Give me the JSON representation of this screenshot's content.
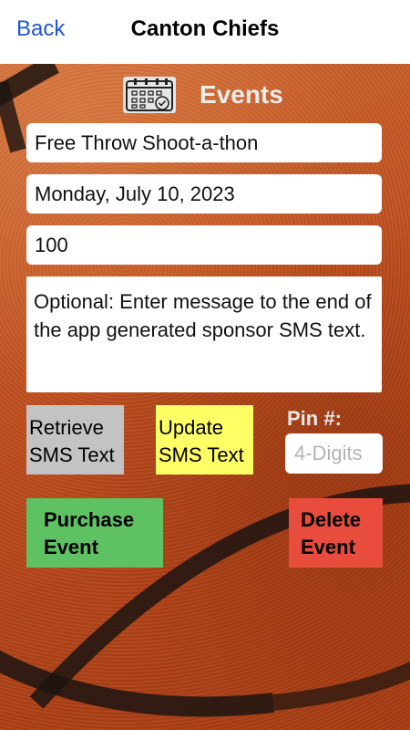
{
  "nav": {
    "back_label": "Back",
    "title": "Canton Chiefs"
  },
  "header": {
    "icon": "calendar-icon",
    "title": "Events"
  },
  "form": {
    "event_name": "Free Throw Shoot-a-thon",
    "event_date": "Monday, July 10, 2023",
    "amount": "100",
    "message_placeholder": "Optional: Enter message to the end of the app generated sponsor SMS text."
  },
  "buttons": {
    "retrieve_line1": "Retrieve",
    "retrieve_line2": "SMS Text",
    "update_line1": "Update",
    "update_line2": "SMS Text",
    "purchase_line1": "Purchase",
    "purchase_line2": "Event",
    "delete_line1": "Delete",
    "delete_line2": "Event"
  },
  "pin": {
    "label": "Pin #:",
    "placeholder": "4-Digits"
  },
  "colors": {
    "back_link": "#1e56d6",
    "retrieve_button": "#c3c3c3",
    "update_button": "#ffff66",
    "purchase_button": "#5fc262",
    "delete_button": "#e74c3c",
    "background": "#c2521f"
  }
}
